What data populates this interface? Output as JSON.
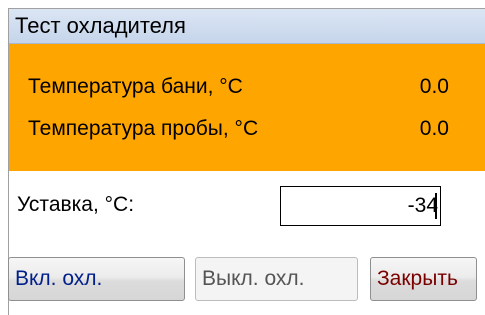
{
  "window": {
    "title": "Тест охладителя"
  },
  "readings": [
    {
      "label": "Температура бани, °C",
      "value": "0.0"
    },
    {
      "label": "Температура пробы, °C",
      "value": "0.0"
    }
  ],
  "setpoint": {
    "label": "Уставка, °C:",
    "value": "-34"
  },
  "buttons": {
    "cooling_on": "Вкл. охл.",
    "cooling_off": "Выкл. охл.",
    "close": "Закрыть"
  },
  "colors": {
    "readings_background": "#ffa500",
    "titlebar": "#c6d5eb",
    "cooling_on_text": "#001f8a",
    "close_text": "#7a0000",
    "disabled_text": "#555555"
  }
}
